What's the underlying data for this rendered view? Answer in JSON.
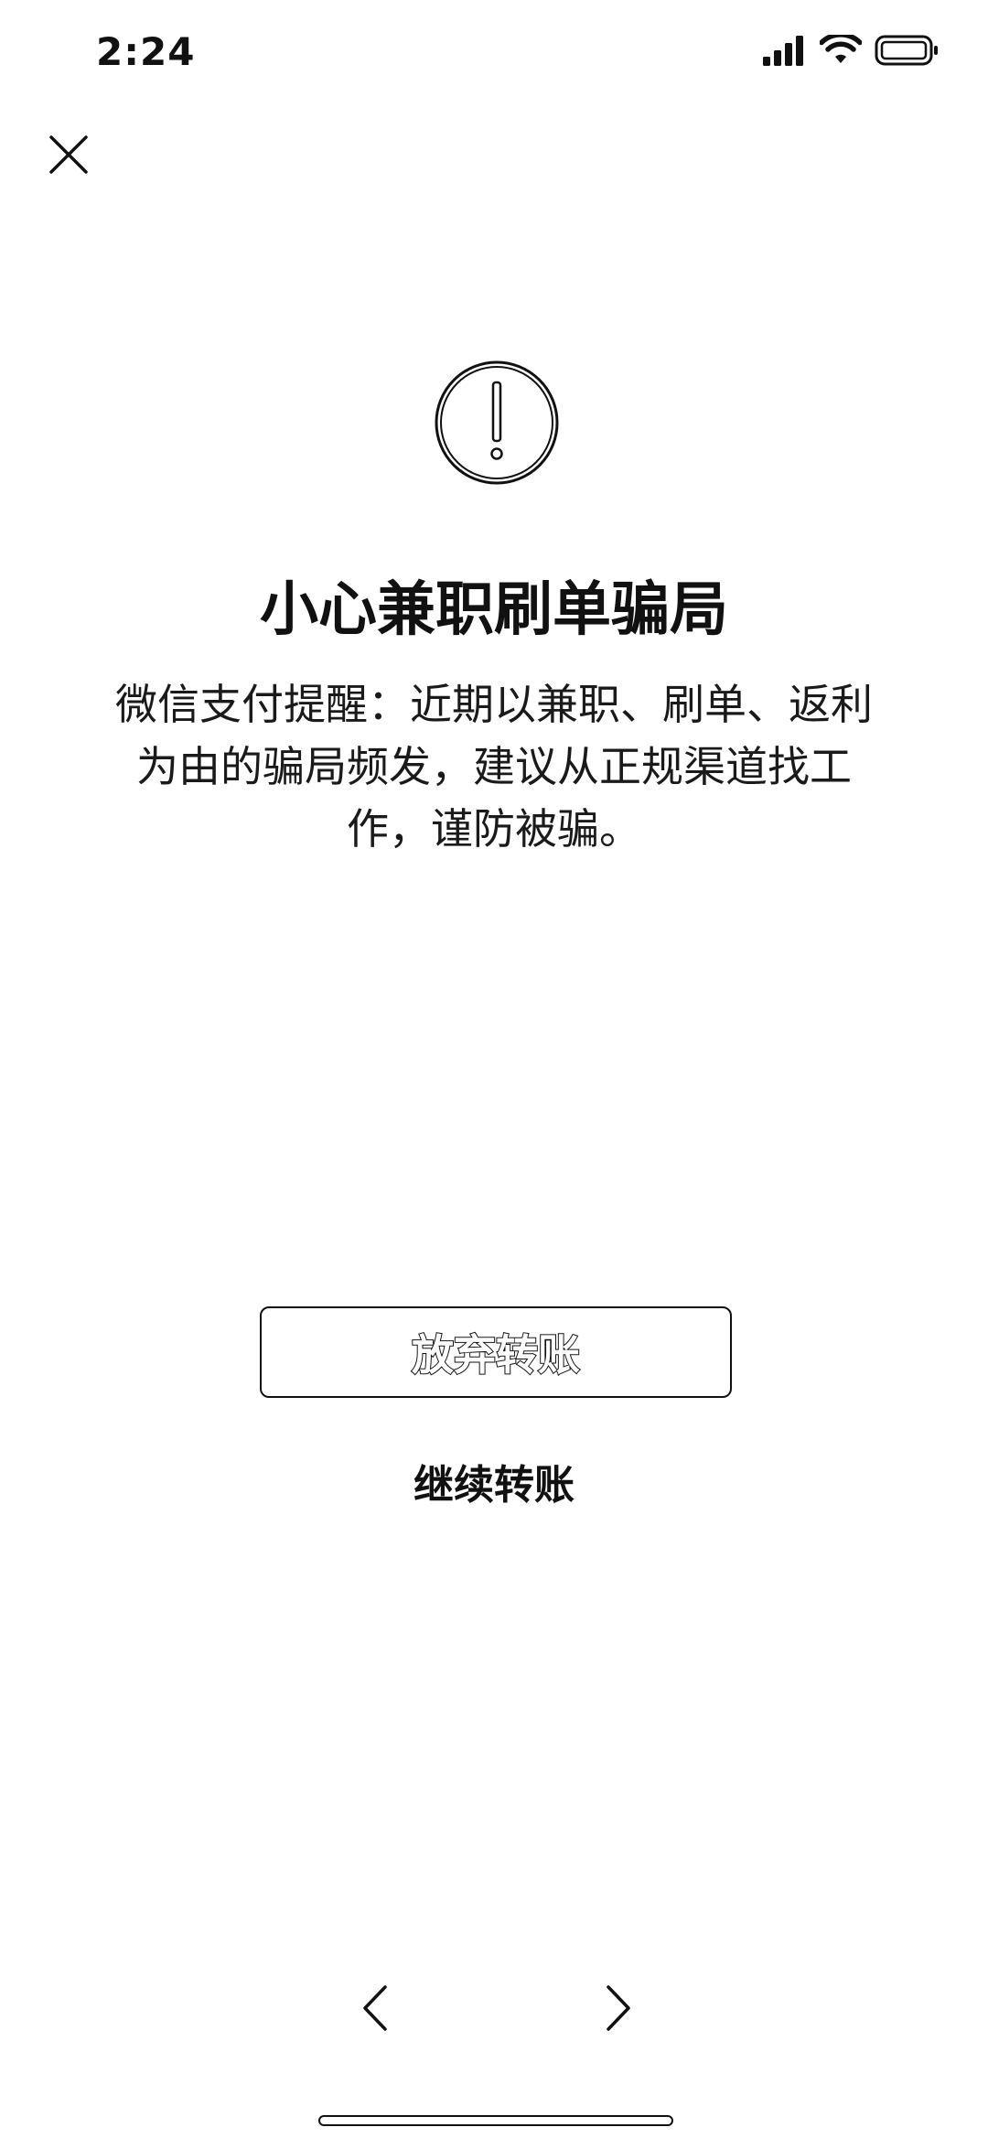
{
  "status_bar": {
    "time": "2:24",
    "icons": [
      "signal-icon",
      "wifi-icon",
      "battery-icon"
    ]
  },
  "dialog": {
    "close_icon": "close-icon",
    "warning_icon": "exclamation-circle-icon",
    "title": "小心兼职刷单骗局",
    "message_lines": [
      "微信支付提醒：近期以兼职、刷单、返利",
      "为由的骗局频发，建议从正规渠道找工",
      "作，谨防被骗。"
    ],
    "cancel_label": "放弃转账",
    "continue_label": "继续转账"
  },
  "browser_nav": {
    "back_icon": "chevron-left-icon",
    "forward_icon": "chevron-right-icon"
  }
}
